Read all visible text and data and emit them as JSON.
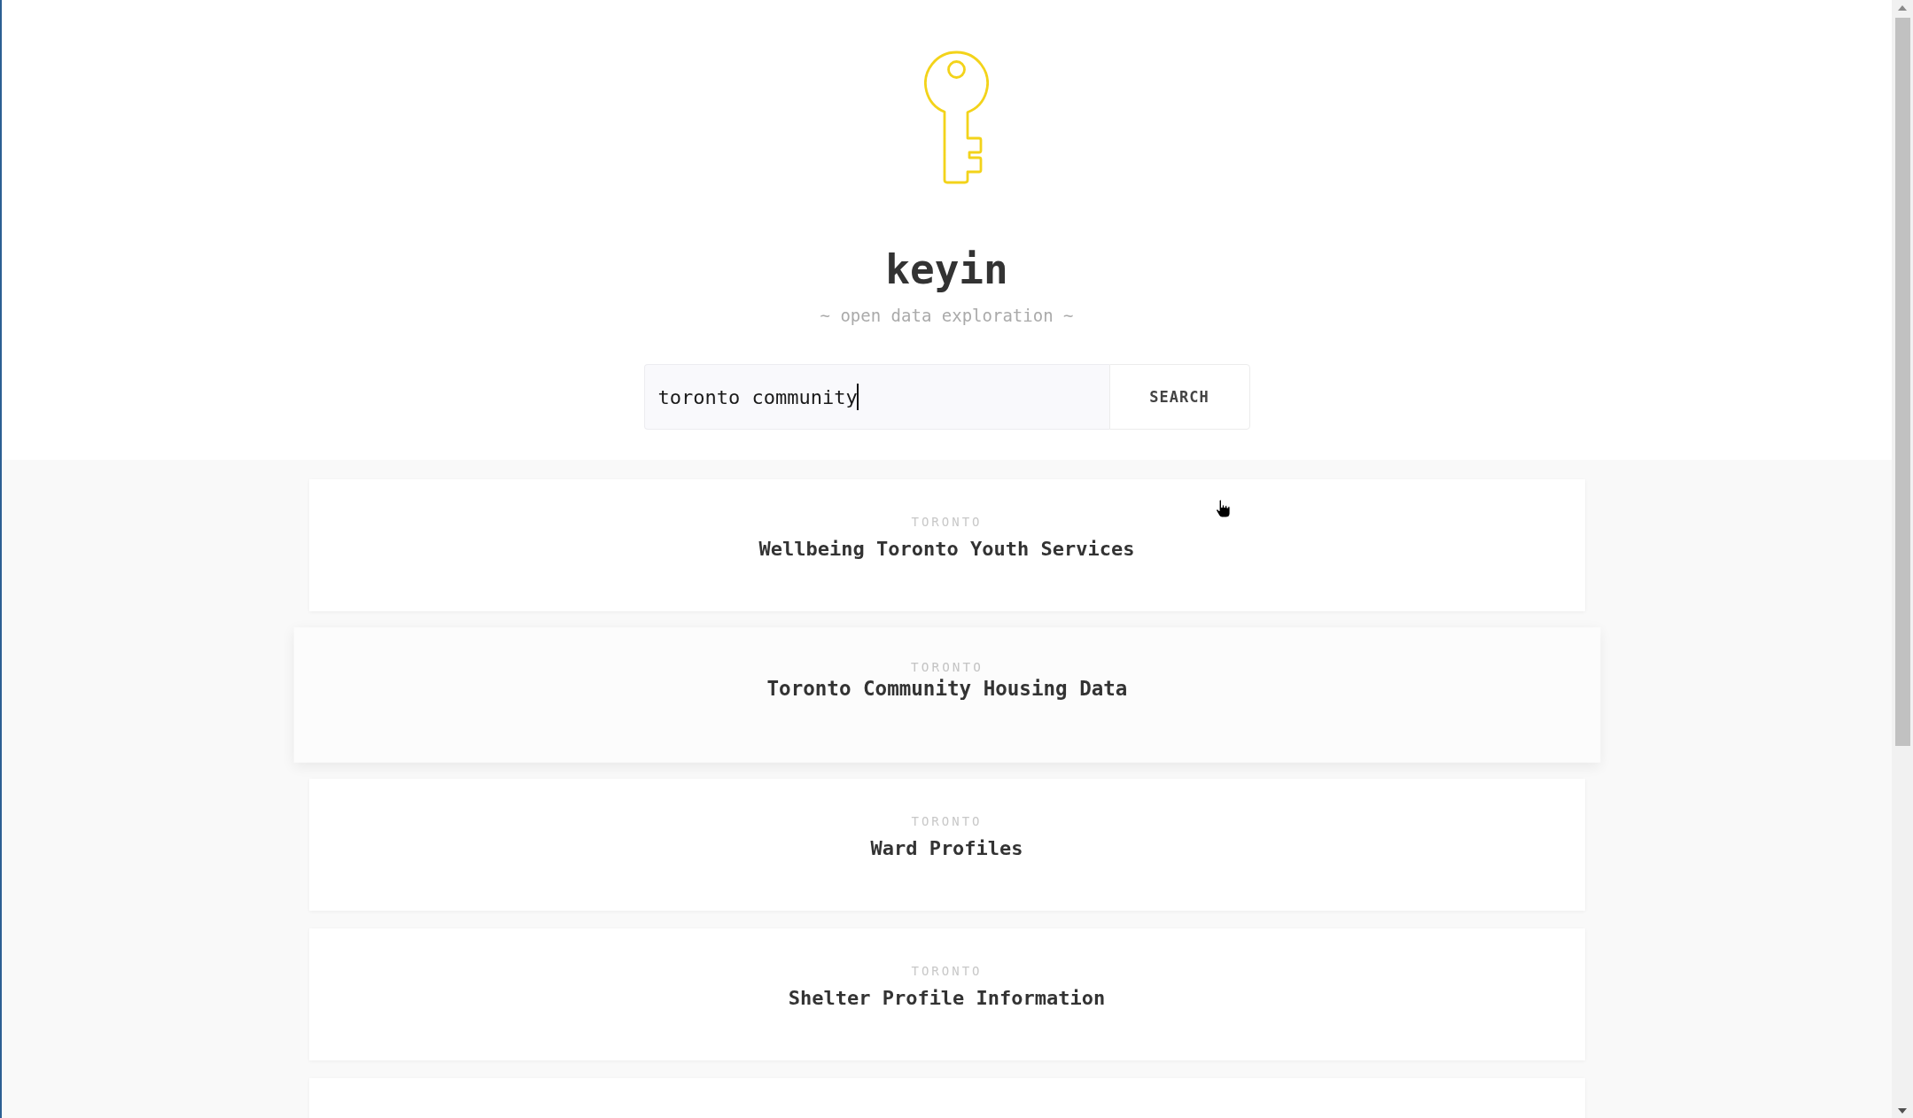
{
  "brand": {
    "name": "keyin",
    "tagline": "~ open data exploration ~"
  },
  "search": {
    "value": "toronto community",
    "focused": true,
    "button": "SEARCH"
  },
  "results": [
    {
      "source": "TORONTO",
      "title": "Wellbeing Toronto Youth Services",
      "highlighted": false
    },
    {
      "source": "TORONTO",
      "title": "Toronto Community Housing Data",
      "highlighted": true
    },
    {
      "source": "TORONTO",
      "title": "Ward Profiles",
      "highlighted": false
    },
    {
      "source": "TORONTO",
      "title": "Shelter Profile Information",
      "highlighted": false
    },
    {
      "highlighted": false
    }
  ]
}
